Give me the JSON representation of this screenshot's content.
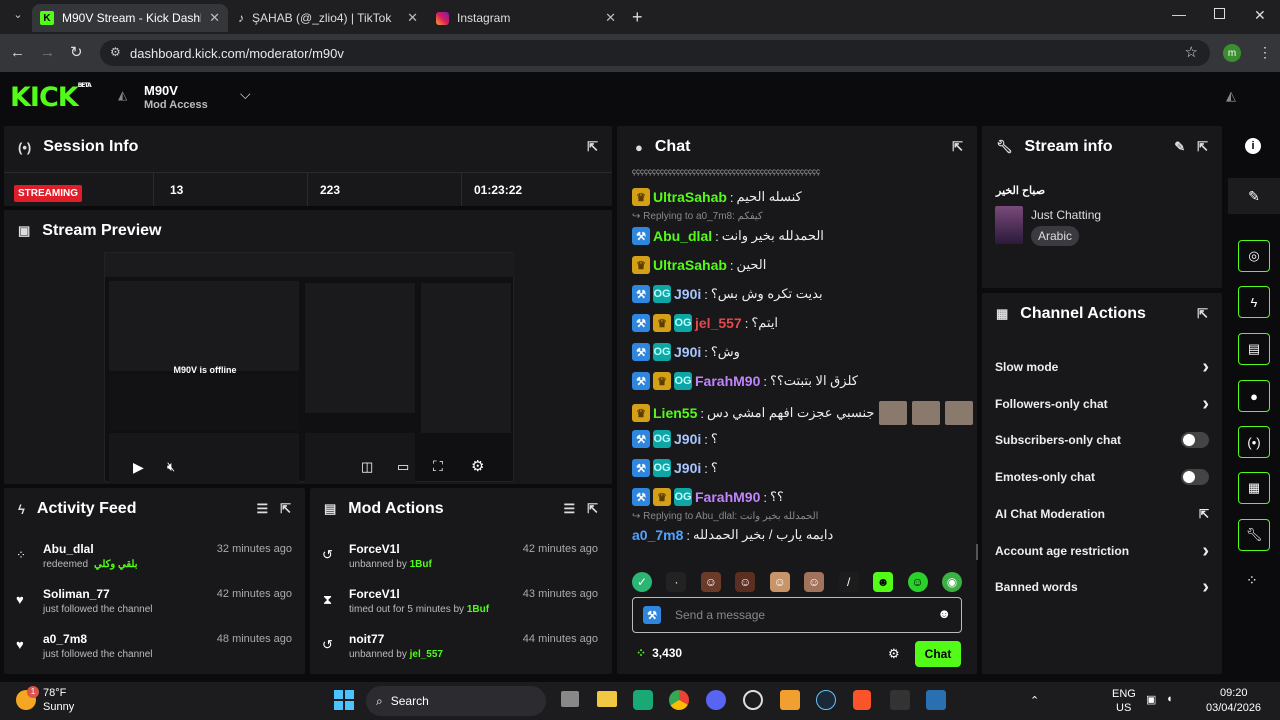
{
  "browser": {
    "tabs": [
      {
        "title": "M90V Stream - Kick Dashboard",
        "favicon": "kick-icon"
      },
      {
        "title": "ŞAHAB (@_zlio4) | TikTok",
        "favicon": "tiktok-icon"
      },
      {
        "title": "Instagram",
        "favicon": "instagram-icon"
      }
    ],
    "url": "dashboard.kick.com/moderator/m90v",
    "profile_initial": "m"
  },
  "header": {
    "logo": "KICK",
    "logo_sup": "BETA",
    "channel": "M90V",
    "role": "Mod Access"
  },
  "session": {
    "title": "Session Info",
    "status": "STREAMING",
    "viewers": "13",
    "followers": "223",
    "uptime": "01:23:22"
  },
  "preview": {
    "title": "Stream Preview",
    "offline_text": "M90V is offline"
  },
  "activity": {
    "title": "Activity Feed",
    "items": [
      {
        "user": "Abu_dlal",
        "text": "redeemed",
        "extra": "بلقي وكلي",
        "time": "32 minutes ago",
        "icon": "points-icon"
      },
      {
        "user": "Soliman_77",
        "text": "just followed the channel",
        "time": "42 minutes ago",
        "icon": "heart-icon"
      },
      {
        "user": "a0_7m8",
        "text": "just followed the channel",
        "time": "48 minutes ago",
        "icon": "heart-icon"
      }
    ]
  },
  "modactions": {
    "title": "Mod Actions",
    "items": [
      {
        "user": "ForceV1l",
        "text": "unbanned by",
        "by": "1Buf",
        "time": "42 minutes ago",
        "icon": "unban-icon"
      },
      {
        "user": "ForceV1l",
        "text": "timed out for 5 minutes by",
        "by": "1Buf",
        "time": "43 minutes ago",
        "icon": "hourglass-icon"
      },
      {
        "user": "noit77",
        "text": "unbanned by",
        "by": "jel_557",
        "time": "44 minutes ago",
        "icon": "unban-icon"
      }
    ]
  },
  "chat": {
    "title": "Chat",
    "top_strip": "ççççççççççççççççççççççççççççççççççççççççççççççç",
    "messages": [
      {
        "user": "UltraSahab",
        "color": "#53fc18",
        "text": "كنسله الحيم",
        "badges": [
          "crown"
        ]
      },
      {
        "reply": "Replying to a0_7m8: كيفكم",
        "user": "Abu_dlal",
        "color": "#53fc18",
        "text": "الحمدلله بخير وانت",
        "badges": [
          "mod"
        ]
      },
      {
        "user": "UltraSahab",
        "color": "#53fc18",
        "text": "الحين",
        "badges": [
          "crown"
        ]
      },
      {
        "user": "J90i",
        "color": "#a8c5ff",
        "text": "بديت تكره وش بس؟",
        "badges": [
          "mod",
          "og"
        ]
      },
      {
        "user": "jel_557",
        "color": "#e5484d",
        "text": "ايتم؟",
        "badges": [
          "mod",
          "crown",
          "og"
        ]
      },
      {
        "user": "J90i",
        "color": "#a8c5ff",
        "text": "وش؟",
        "badges": [
          "mod",
          "og"
        ]
      },
      {
        "user": "FarahM90",
        "color": "#c084fc",
        "text": "كلزق الا بتبتت؟؟",
        "badges": [
          "mod",
          "crown",
          "og"
        ]
      },
      {
        "user": "Lien55",
        "color": "#53fc18",
        "text": "جنسبي عجزت افهم امشي دس",
        "badges": [
          "crown"
        ],
        "emotes": 3
      },
      {
        "user": "J90i",
        "color": "#a8c5ff",
        "text": "؟",
        "badges": [
          "mod",
          "og"
        ]
      },
      {
        "user": "J90i",
        "color": "#a8c5ff",
        "text": "؟",
        "badges": [
          "mod",
          "og"
        ]
      },
      {
        "user": "FarahM90",
        "color": "#c084fc",
        "text": "؟؟",
        "badges": [
          "mod",
          "crown",
          "og"
        ]
      },
      {
        "reply": "Replying to Abu_dlal: الحمدلله بخير وانت",
        "user": "a0_7m8",
        "color": "#4fa3ff",
        "text": "دايمه يارب / بخير الحمدلله",
        "badges": []
      }
    ],
    "input_placeholder": "Send a message",
    "points": "3,430",
    "send_label": "Chat"
  },
  "streaminfo": {
    "title": "Stream info",
    "stream_title": "صباح الخير",
    "category": "Just Chatting",
    "tag": "Arabic"
  },
  "channelactions": {
    "title": "Channel Actions",
    "items": [
      {
        "label": "Slow mode",
        "control": "chevron"
      },
      {
        "label": "Followers-only chat",
        "control": "chevron"
      },
      {
        "label": "Subscribers-only chat",
        "control": "toggle"
      },
      {
        "label": "Emotes-only chat",
        "control": "toggle"
      },
      {
        "label": "AI Chat Moderation",
        "control": "external"
      },
      {
        "label": "Account age restriction",
        "control": "chevron"
      },
      {
        "label": "Banned words",
        "control": "chevron"
      }
    ]
  },
  "taskbar": {
    "weather_temp": "78°F",
    "weather_text": "Sunny",
    "weather_badge": "1",
    "search": "Search",
    "lang": "ENG",
    "region": "US",
    "time": "09:20",
    "date": "03/04/2026"
  },
  "colors": {
    "brand": "#53fc18",
    "panel": "#18181b",
    "bg": "#0b0b0d"
  }
}
